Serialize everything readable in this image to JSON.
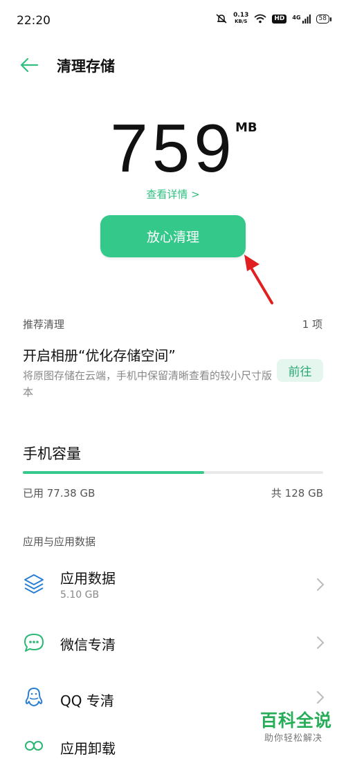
{
  "status": {
    "time": "22:20",
    "speed_value": "0.13",
    "speed_unit": "KB/S",
    "hd": "HD",
    "network": "4G",
    "battery": "58"
  },
  "header": {
    "title": "清理存储"
  },
  "summary": {
    "amount": "759",
    "unit": "MB",
    "details_link": "查看详情 >",
    "clean_button": "放心清理"
  },
  "recommend": {
    "label": "推荐清理",
    "count": "1 项",
    "item_title": "开启相册“优化存储空间”",
    "item_desc": "将原图存储在云端，手机中保留清晰查看的较小尺寸版本",
    "go_button": "前往"
  },
  "capacity": {
    "title": "手机容量",
    "used_label": "已用 77.38 GB",
    "total_label": "共 128 GB",
    "used_fraction": 0.6045
  },
  "apps_section": {
    "label": "应用与应用数据",
    "items": [
      {
        "title": "应用数据",
        "subtitle": "5.10 GB",
        "icon": "layers-icon"
      },
      {
        "title": "微信专清",
        "icon": "chat-bubble-icon"
      },
      {
        "title": "QQ 专清",
        "icon": "penguin-icon"
      },
      {
        "title": "应用卸载",
        "icon": "app-uninstall-icon"
      }
    ]
  },
  "watermark": {
    "main": "百科全说",
    "sub": "助你轻松解决"
  },
  "colors": {
    "accent": "#34c98a",
    "accent_text": "#2fbf7f",
    "arrow": "#e02020",
    "watermark": "#27ad57"
  }
}
